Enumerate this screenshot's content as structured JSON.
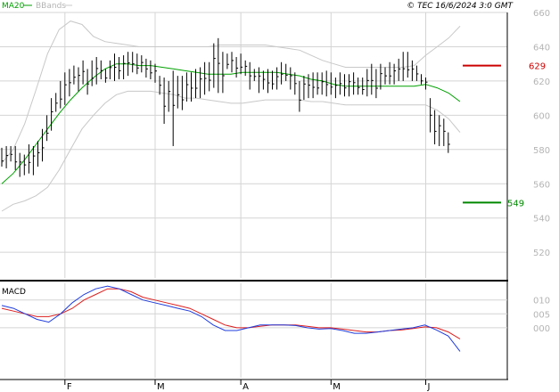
{
  "header": {
    "legend_ma": "MA20",
    "legend_bbands": "BBands",
    "copyright": "© TEC 16/6/2024 3:0 GMT"
  },
  "colors": {
    "price": "#000000",
    "ma": "#00a000",
    "bband": "#c8c8c8",
    "macd": "#1e3cdc",
    "signal": "#dc1e1e",
    "resistance": "#cc0000",
    "support": "#008800",
    "grid": "#d4d4d4",
    "axis_text": "#b4b4b4"
  },
  "chart_data": [
    {
      "type": "line",
      "name": "price-panel",
      "ylim": [
        505,
        660
      ],
      "yticks": [
        520,
        540,
        560,
        580,
        600,
        620,
        640,
        660
      ],
      "x_months": [
        "F",
        "M",
        "A",
        "M",
        "J"
      ],
      "x_month_index": [
        14,
        34,
        53,
        73,
        94
      ],
      "n_sessions": 103,
      "series": [
        {
          "name": "Price",
          "style": "ohlc-bars",
          "lows": [
            570,
            569,
            573,
            568,
            564,
            565,
            566,
            565,
            570,
            573,
            585,
            591,
            602,
            604,
            606,
            611,
            618,
            614,
            618,
            612,
            617,
            618,
            621,
            619,
            621,
            620,
            621,
            621,
            623,
            625,
            624,
            625,
            622,
            621,
            619,
            612,
            595,
            602,
            582,
            604,
            603,
            608,
            608,
            610,
            610,
            612,
            614,
            616,
            613,
            613,
            627,
            625,
            622,
            624,
            623,
            615,
            620,
            613,
            615,
            613,
            615,
            615,
            618,
            620,
            615,
            612,
            602,
            609,
            610,
            610,
            612,
            612,
            611,
            612,
            610,
            612,
            611,
            611,
            612,
            612,
            612,
            611,
            612,
            610,
            615,
            618,
            618,
            618,
            620,
            620,
            622,
            620,
            620,
            618,
            615,
            590,
            583,
            582,
            582,
            578
          ],
          "highs": [
            581,
            582,
            582,
            582,
            578,
            577,
            583,
            582,
            585,
            592,
            600,
            610,
            613,
            620,
            625,
            627,
            629,
            628,
            632,
            627,
            632,
            634,
            632,
            627,
            632,
            636,
            634,
            635,
            637,
            637,
            636,
            635,
            633,
            632,
            630,
            623,
            622,
            620,
            626,
            623,
            623,
            625,
            625,
            627,
            628,
            631,
            631,
            642,
            645,
            637,
            636,
            637,
            634,
            636,
            632,
            631,
            627,
            628,
            626,
            627,
            626,
            628,
            631,
            630,
            628,
            625,
            620,
            623,
            624,
            625,
            625,
            625,
            626,
            625,
            622,
            625,
            624,
            624,
            625,
            622,
            622,
            627,
            630,
            627,
            630,
            628,
            631,
            630,
            633,
            637,
            637,
            632,
            629,
            624,
            622,
            610,
            603,
            600,
            598,
            590
          ]
        },
        {
          "name": "MA20",
          "values": [
            560,
            566,
            574,
            583,
            592,
            601,
            609,
            616,
            622,
            627,
            630,
            630,
            629,
            629,
            628,
            627,
            626,
            625,
            624,
            624,
            624,
            625,
            625,
            625,
            625,
            624,
            623,
            621,
            620,
            618,
            617,
            617,
            617,
            617,
            617,
            617,
            617,
            618,
            616,
            613,
            608
          ]
        },
        {
          "name": "BBand upper",
          "values": [
            572,
            580,
            595,
            615,
            636,
            650,
            655,
            653,
            646,
            643,
            642,
            641,
            640,
            640,
            640,
            640,
            640,
            640,
            640,
            641,
            641,
            641,
            641,
            641,
            640,
            639,
            638,
            635,
            632,
            630,
            628,
            628,
            628,
            628,
            628,
            628,
            629,
            635,
            640,
            645,
            652
          ]
        },
        {
          "name": "BBand lower",
          "values": [
            544,
            548,
            550,
            553,
            558,
            568,
            580,
            592,
            600,
            607,
            612,
            614,
            614,
            614,
            613,
            612,
            610,
            610,
            609,
            608,
            607,
            607,
            608,
            609,
            609,
            609,
            609,
            608,
            608,
            607,
            606,
            606,
            606,
            606,
            606,
            606,
            606,
            606,
            603,
            598,
            590
          ]
        }
      ],
      "annotations": [
        {
          "label": "629",
          "value": 629,
          "kind": "resistance"
        },
        {
          "label": "549",
          "value": 549,
          "kind": "support"
        }
      ]
    },
    {
      "type": "line",
      "name": "macd-panel",
      "title": "MACD",
      "ylim": [
        -0.018,
        0.016
      ],
      "yticks": [
        0.0,
        0.05,
        0.1
      ],
      "ytick_labels": [
        "000",
        "005",
        "010"
      ],
      "series": [
        {
          "name": "MACD",
          "values": [
            0.008,
            0.007,
            0.005,
            0.003,
            0.002,
            0.005,
            0.009,
            0.012,
            0.014,
            0.015,
            0.014,
            0.012,
            0.01,
            0.009,
            0.008,
            0.007,
            0.006,
            0.004,
            0.001,
            -0.001,
            -0.001,
            0.0,
            0.001,
            0.001,
            0.001,
            0.0008,
            0.0,
            -0.0005,
            -0.0003,
            -0.001,
            -0.002,
            -0.002,
            -0.0015,
            -0.001,
            -0.0005,
            0.0,
            0.001,
            -0.0008,
            -0.003,
            -0.0085
          ]
        },
        {
          "name": "Signal",
          "values": [
            0.007,
            0.006,
            0.005,
            0.004,
            0.004,
            0.005,
            0.007,
            0.01,
            0.012,
            0.014,
            0.014,
            0.013,
            0.011,
            0.01,
            0.009,
            0.008,
            0.007,
            0.005,
            0.003,
            0.001,
            0.0,
            0.0,
            0.0005,
            0.001,
            0.001,
            0.001,
            0.0005,
            0.0,
            0.0,
            -0.0005,
            -0.001,
            -0.0015,
            -0.0015,
            -0.001,
            -0.0008,
            -0.0003,
            0.0003,
            0.0,
            -0.0015,
            -0.004
          ]
        }
      ]
    }
  ]
}
